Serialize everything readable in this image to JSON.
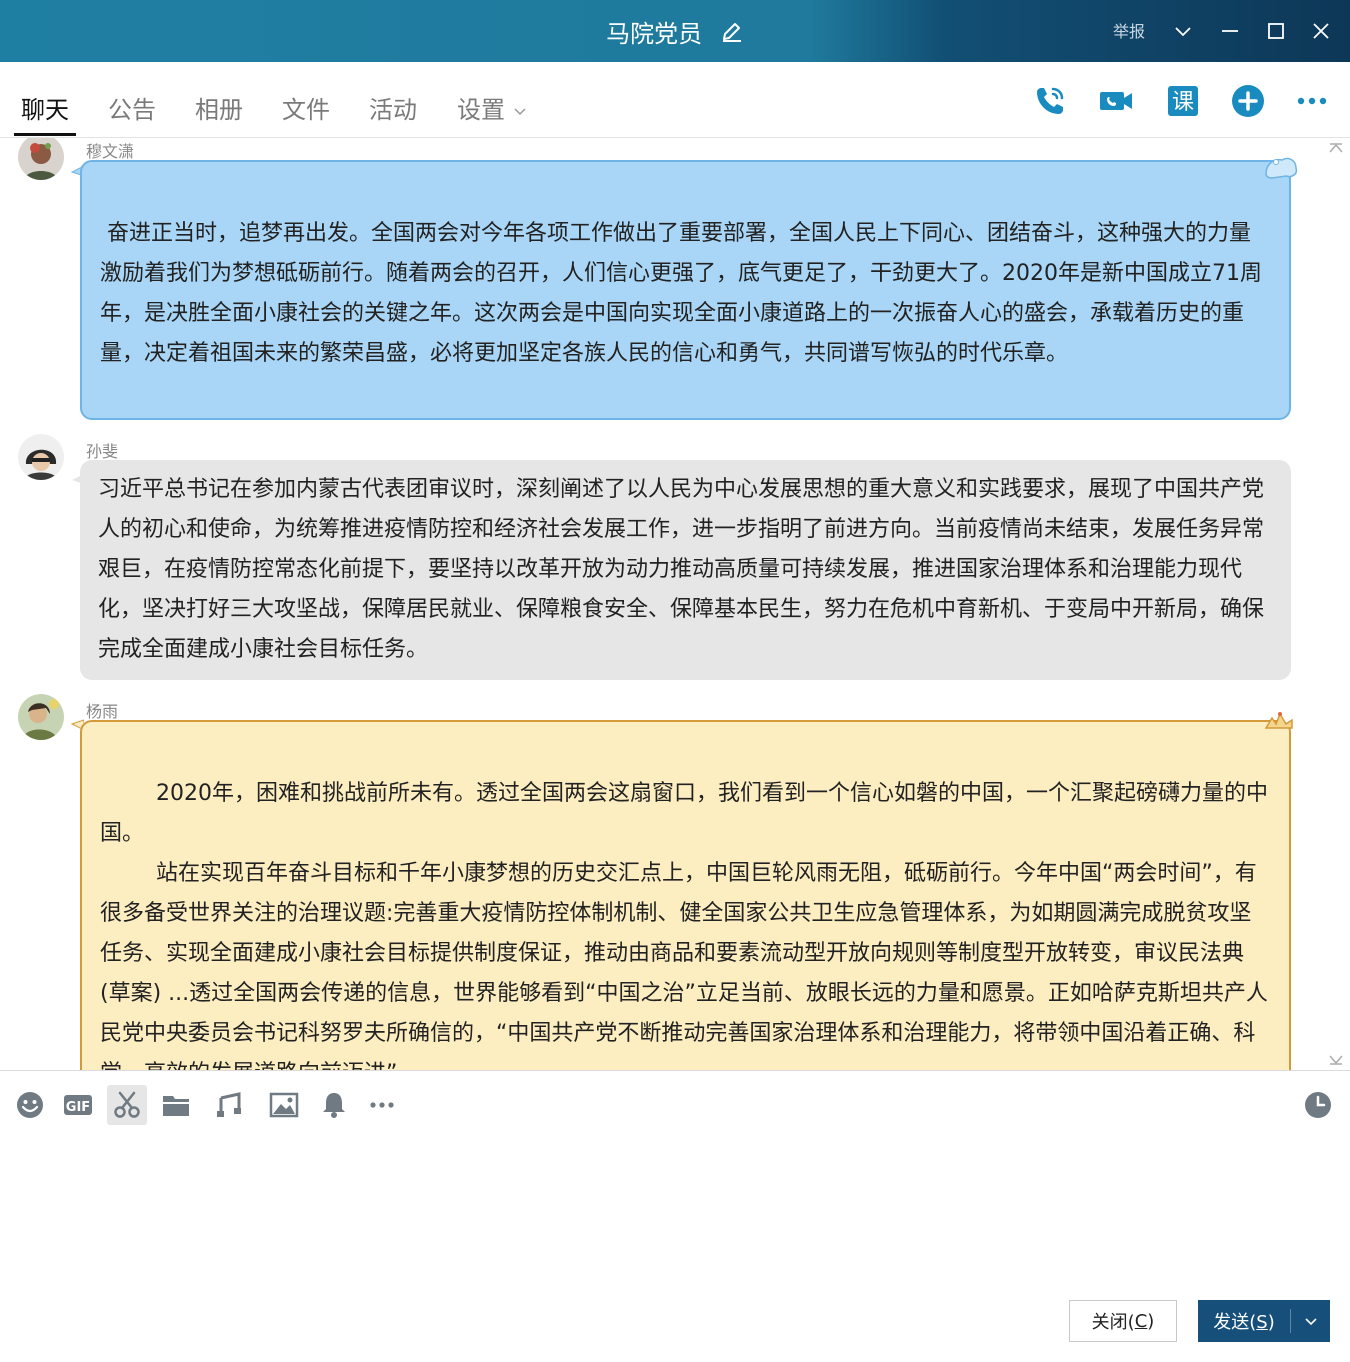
{
  "window": {
    "title": "马院党员",
    "report_label": "举报"
  },
  "tabs": [
    {
      "label": "聊天",
      "active": true
    },
    {
      "label": "公告"
    },
    {
      "label": "相册"
    },
    {
      "label": "文件"
    },
    {
      "label": "活动"
    },
    {
      "label": "设置"
    }
  ],
  "header_tools": [
    "phone-icon",
    "video-call-icon",
    "class-icon",
    "add-icon",
    "more-icon"
  ],
  "class_icon_text": "课",
  "messages": [
    {
      "sender": "穆文潇",
      "style": "blue",
      "text": " 奋进正当时，追梦再出发。全国两会对今年各项工作做出了重要部署，全国人民上下同心、团结奋斗，这种强大的力量激励着我们为梦想砥砺前行。随着两会的召开，人们信心更强了，底气更足了，干劲更大了。2020年是新中国成立71周年，是决胜全面小康社会的关键之年。这次两会是中国向实现全面小康道路上的一次振奋人心的盛会，承载着历史的重量，决定着祖国未来的繁荣昌盛，必将更加坚定各族人民的信心和勇气，共同谱写恢弘的时代乐章。"
    },
    {
      "sender": "孙斐",
      "style": "gray",
      "text": "习近平总书记在参加内蒙古代表团审议时，深刻阐述了以人民为中心发展思想的重大意义和实践要求，展现了中国共产党人的初心和使命，为统筹推进疫情防控和经济社会发展工作，进一步指明了前进方向。当前疫情尚未结束，发展任务异常艰巨，在疫情防控常态化前提下，要坚持以改革开放为动力推动高质量可持续发展，推进国家治理体系和治理能力现代化，坚决打好三大攻坚战，保障居民就业、保障粮食安全、保障基本民生，努力在危机中育新机、于变局中开新局，确保完成全面建成小康社会目标任务。"
    },
    {
      "sender": "杨雨",
      "style": "yellow",
      "text": "        2020年，困难和挑战前所未有。透过全国两会这扇窗口，我们看到一个信心如磐的中国，一个汇聚起磅礴力量的中国。\n        站在实现百年奋斗目标和千年小康梦想的历史交汇点上，中国巨轮风雨无阻，砥砺前行。今年中国“两会时间”，有很多备受世界关注的治理议题:完善重大疫情防控体制机制、健全国家公共卫生应急管理体系，为如期圆满完成脱贫攻坚任务、实现全面建成小康社会目标提供制度保证，推动由商品和要素流动型开放向规则等制度型开放转变，审议民法典(草案) ...透过全国两会传递的信息，世界能够看到“中国之治”立足当前、放眼长远的力量和愿景。正如哈萨克斯坦共产人民党中央委员会书记科努罗夫所确信的，“中国共产党不断推动完善国家治理体系和治理能力，将带领中国沿着正确、科学、高效的发展道路向前迈进”"
    }
  ],
  "input_tools": [
    "emoji-icon",
    "gif-icon",
    "screenshot-icon",
    "folder-icon",
    "music-icon",
    "image-icon",
    "bell-icon",
    "more-icon",
    "history-icon"
  ],
  "gif_text": "GIF",
  "buttons": {
    "close": {
      "text": "关闭(",
      "key": "C",
      "tail": ")"
    },
    "send": {
      "text": "发送(",
      "key": "S",
      "tail": ")"
    }
  },
  "colors": {
    "titlebar": "#1f7fa3",
    "accent": "#1a8bbf",
    "send_button": "#154f7a",
    "bubble_blue": "#a9d6f6",
    "bubble_gray": "#e6e6e6",
    "bubble_yellow": "#fdeec2"
  }
}
